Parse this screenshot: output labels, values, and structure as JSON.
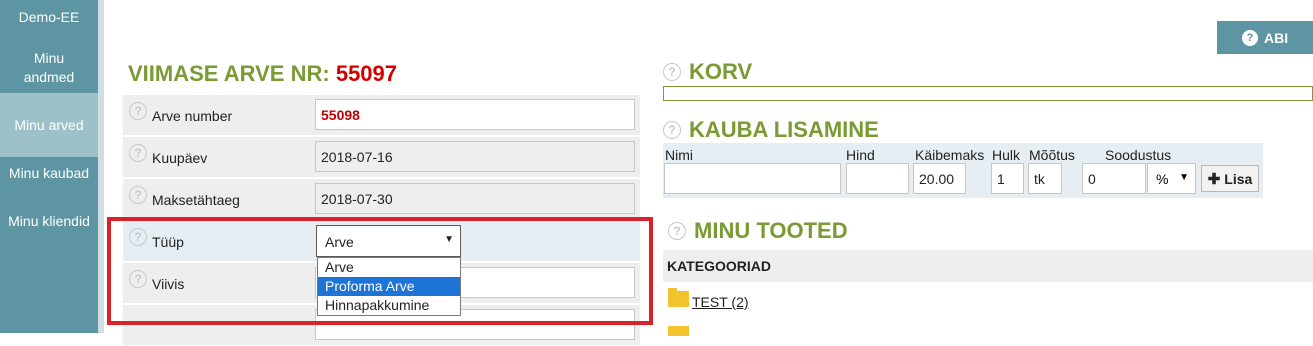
{
  "sidebar": {
    "items": [
      {
        "label": "Demo-EE"
      },
      {
        "label": "Minu andmed"
      },
      {
        "label": "Minu arved"
      },
      {
        "label": "Minu kaubad"
      },
      {
        "label": "Minu kliendid"
      }
    ]
  },
  "help": {
    "label": "ABI",
    "icon": "question-circle-icon"
  },
  "invoice": {
    "title": "VIIMASE ARVE NR:",
    "last_number": "55097",
    "fields": {
      "number_label": "Arve number",
      "number_value": "55098",
      "date_label": "Kuupäev",
      "date_value": "2018-07-16",
      "due_label": "Maksetähtaeg",
      "due_value": "2018-07-30",
      "type_label": "Tüüp",
      "type_value": "Arve",
      "ref_label": "Viivis"
    },
    "type_options": [
      "Arve",
      "Proforma Arve",
      "Hinnapakkumine"
    ],
    "type_highlighted": "Proforma Arve"
  },
  "cart": {
    "title": "KORV"
  },
  "add_product": {
    "title": "KAUBA LISAMINE",
    "labels": {
      "name": "Nimi",
      "price": "Hind",
      "vat": "Käibemaks",
      "qty": "Hulk",
      "unit": "Mõõtus",
      "discount": "Soodustus"
    },
    "values": {
      "name": "",
      "price": "",
      "vat": "20.00",
      "qty": "1",
      "unit": "tk",
      "discount": "0",
      "discount_type": "%"
    },
    "add_button": "Lisa"
  },
  "products": {
    "title": "MINU TOOTED",
    "categories_header": "KATEGOORIAD",
    "categories": [
      {
        "label": "TEST (2)"
      }
    ]
  },
  "colors": {
    "accent": "#5e95a3",
    "title_green": "#7a9a34",
    "alert_red": "#d40000",
    "highlight_box": "#d8232a"
  }
}
